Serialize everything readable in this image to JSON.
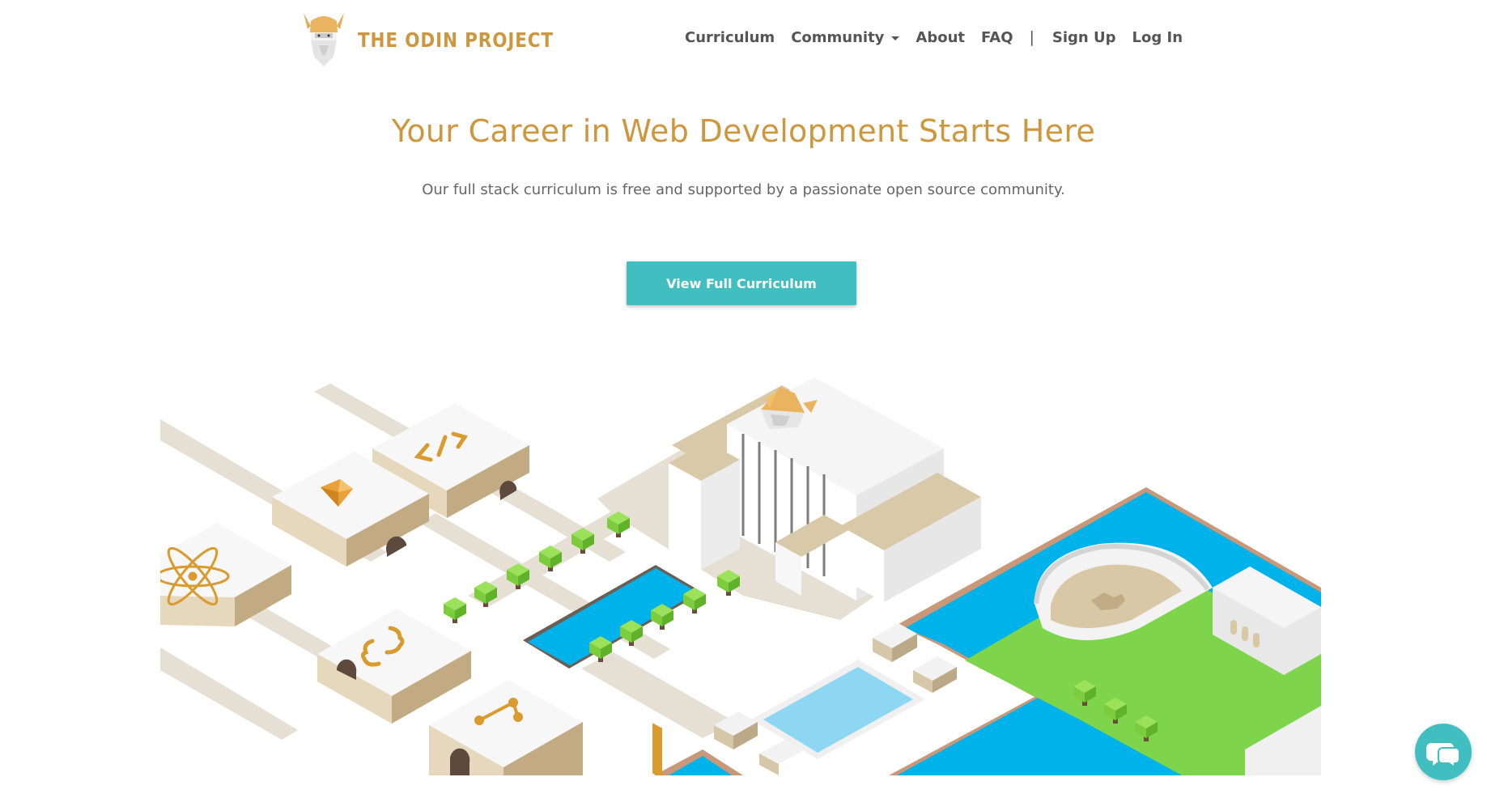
{
  "brand": {
    "name": "THE ODIN PROJECT",
    "logo_icon": "odin-viking-head-icon",
    "color": "#ce973e"
  },
  "nav": {
    "items": [
      {
        "label": "Curriculum"
      },
      {
        "label": "Community",
        "has_dropdown": true
      },
      {
        "label": "About"
      },
      {
        "label": "FAQ"
      }
    ],
    "separator": "|",
    "sign_up": "Sign Up",
    "log_in": "Log In"
  },
  "hero": {
    "title": "Your Career in Web Development Starts Here",
    "subtitle": "Our full stack curriculum is free and supported by a passionate open source community.",
    "cta_label": "View Full Curriculum"
  },
  "illustration": {
    "icons": [
      "html-code-icon",
      "gem-icon",
      "react-atom-icon",
      "curly-braces-icon",
      "git-branch-icon",
      "odin-viking-head-icon"
    ]
  },
  "colors": {
    "accent": "#41bfc0",
    "brand": "#ce973e",
    "water": "#00b2ea",
    "grass": "#7ed44a"
  },
  "chat": {
    "icon": "chat-bubbles-icon"
  }
}
